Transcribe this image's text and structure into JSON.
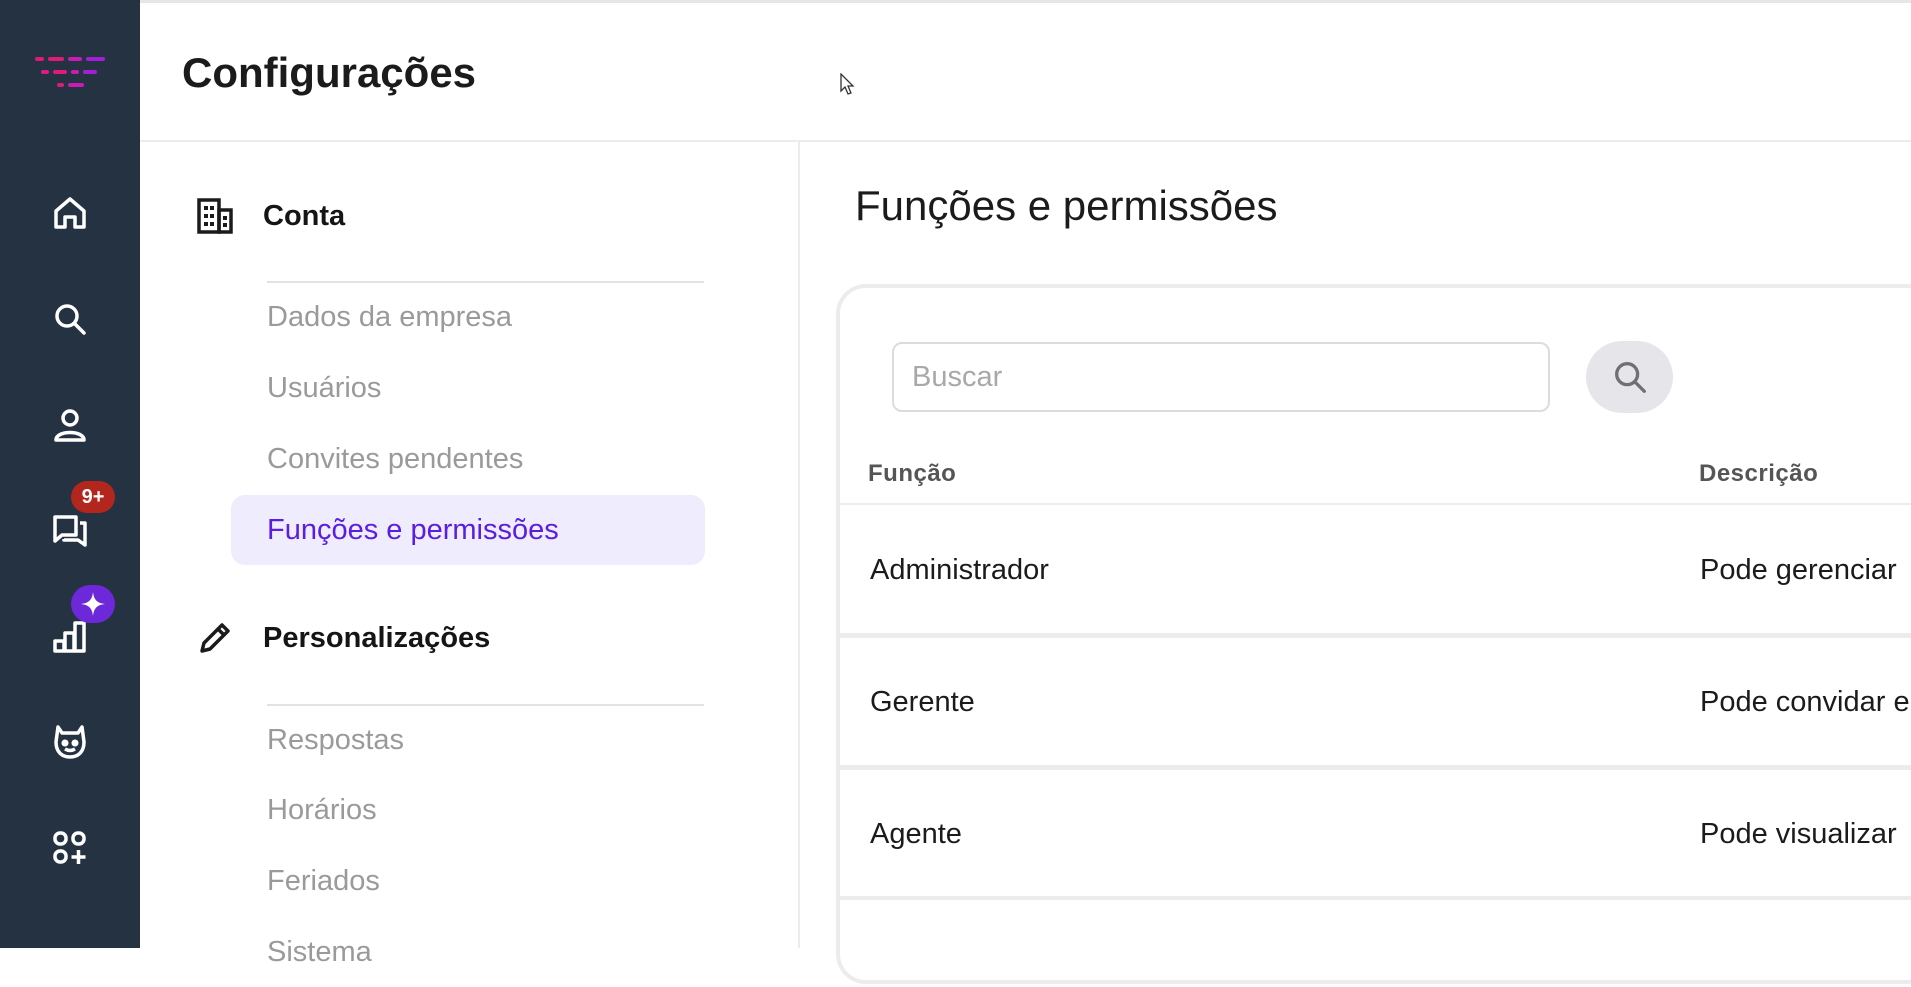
{
  "header": {
    "title": "Configurações"
  },
  "sidebar_rail": {
    "items": [
      {
        "name": "home",
        "icon": "home-icon"
      },
      {
        "name": "search",
        "icon": "search-icon"
      },
      {
        "name": "contacts",
        "icon": "person-icon"
      },
      {
        "name": "conversations",
        "icon": "chat-icon",
        "badge": "9+"
      },
      {
        "name": "reports",
        "icon": "bar-chart-icon",
        "badge_icon": "sparkle-icon"
      },
      {
        "name": "bot",
        "icon": "robot-icon"
      },
      {
        "name": "apps",
        "icon": "apps-add-icon"
      }
    ],
    "colors": {
      "background": "#243242",
      "badge": "#b3261e",
      "ai_badge": "#6d28d9"
    }
  },
  "settings_menu": {
    "sections": [
      {
        "title": "Conta",
        "icon": "building-icon",
        "items": [
          "Dados da empresa",
          "Usuários",
          "Convites pendentes",
          "Funções e permissões"
        ]
      },
      {
        "title": "Personalizações",
        "icon": "pencil-icon",
        "items": [
          "Respostas",
          "Horários",
          "Feriados",
          "Sistema"
        ]
      }
    ],
    "active_item": "Funções e permissões",
    "colors": {
      "active_bg": "#efecfd",
      "active_text": "#5b1ee0"
    }
  },
  "main": {
    "title": "Funções e permissões",
    "search": {
      "placeholder": "Buscar",
      "value": ""
    },
    "table": {
      "columns": [
        "Função",
        "Descrição"
      ],
      "rows": [
        {
          "role": "Administrador",
          "description": "Pode gerenciar"
        },
        {
          "role": "Gerente",
          "description": "Pode convidar e"
        },
        {
          "role": "Agente",
          "description": "Pode visualizar"
        }
      ]
    }
  }
}
